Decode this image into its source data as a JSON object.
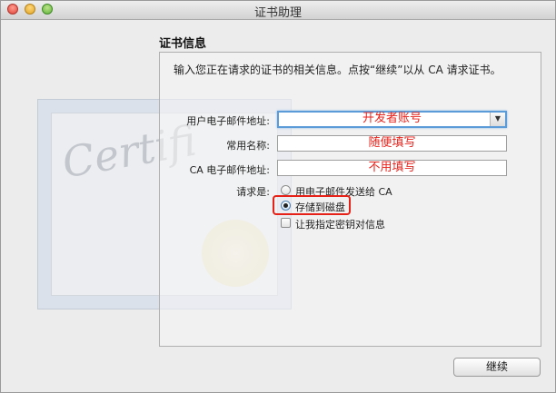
{
  "window": {
    "title": "证书助理"
  },
  "section_title": "证书信息",
  "intro_text": "输入您正在请求的证书的相关信息。点按“继续”以从 CA 请求证书。",
  "background": {
    "cert_word": "Certifi"
  },
  "fields": {
    "user_email": {
      "label": "用户电子邮件地址:",
      "value": "开发者账号"
    },
    "common_name": {
      "label": "常用名称:",
      "value": "随便填写"
    },
    "ca_email": {
      "label": "CA 电子邮件地址:",
      "value": "不用填写"
    }
  },
  "request": {
    "label": "请求是:",
    "option_email": "用电子邮件发送给 CA",
    "option_disk": "存储到磁盘",
    "selected": "存储到磁盘",
    "checkbox_label": "让我指定密钥对信息",
    "checkbox_checked": false
  },
  "buttons": {
    "continue": "继续"
  },
  "colors": {
    "annotation_red": "#e8231c",
    "focus_blue": "#5b9bd8"
  }
}
